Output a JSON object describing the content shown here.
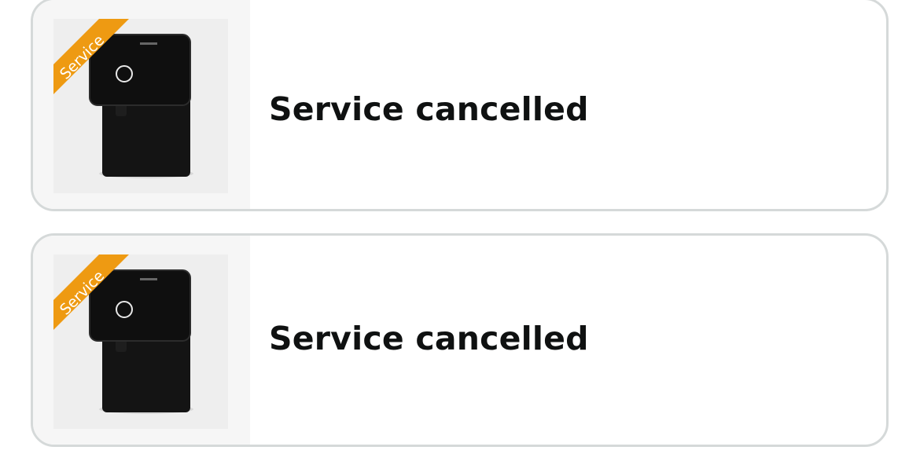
{
  "orders": [
    {
      "badge_label": "Service",
      "status_label": "Service cancelled",
      "badge_color": "#ee9a12",
      "product_icon": "water-purifier-image"
    },
    {
      "badge_label": "Service",
      "status_label": "Service cancelled",
      "badge_color": "#ee9a12",
      "product_icon": "water-purifier-image"
    }
  ]
}
